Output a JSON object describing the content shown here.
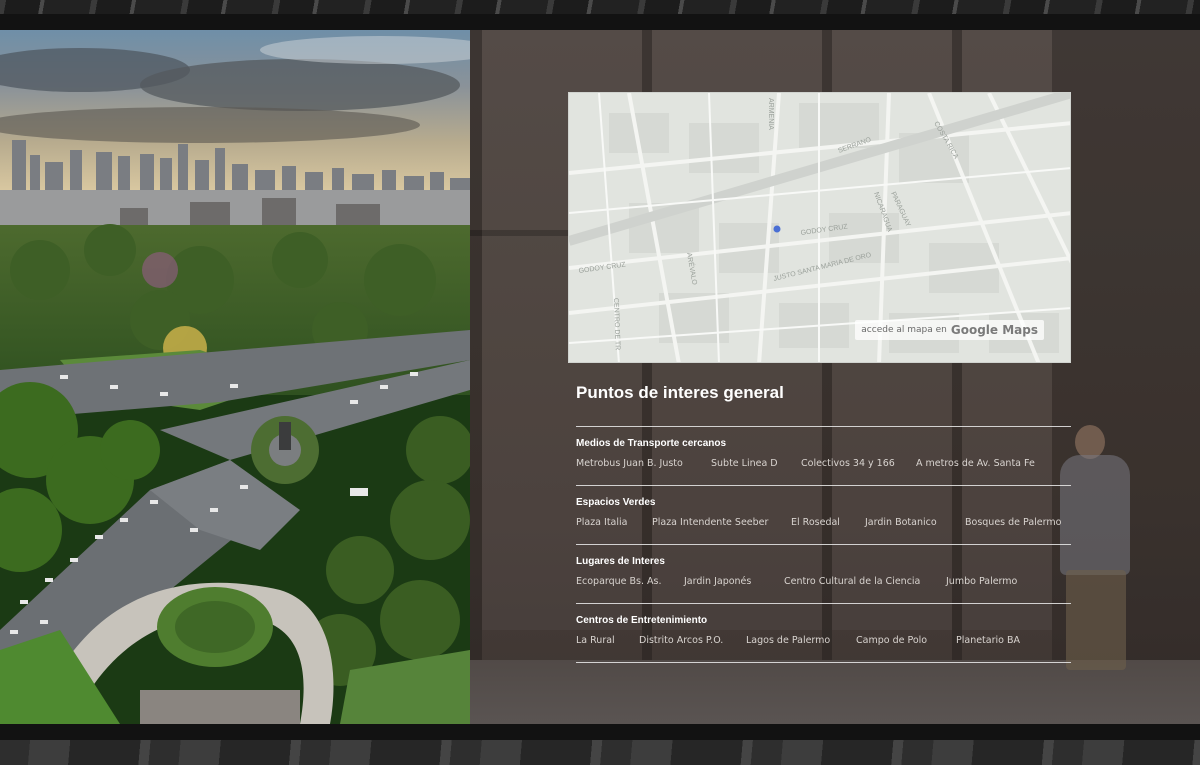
{
  "map": {
    "streets": [
      "GODOY CRUZ",
      "GODOY CRUZ",
      "JUSTO SANTA MARIA DE ORO",
      "CENTRO DE TR",
      "ARMENIA",
      "NICARAGUA",
      "PARAGUAY",
      "COSTA RICA",
      "SERRANO",
      "ARÉVALO"
    ],
    "link_prefix": "accede al mapa en",
    "link_brand": "Google Maps"
  },
  "info": {
    "title": "Puntos de interes general",
    "categories": [
      {
        "name": "Medios de Transporte cercanos",
        "items": [
          "Metrobus Juan B. Justo",
          "Subte Linea D",
          "Colectivos 34 y 166",
          "A metros de Av. Santa Fe"
        ]
      },
      {
        "name": "Espacios Verdes",
        "items": [
          "Plaza Italia",
          "Plaza Intendente Seeber",
          "El Rosedal",
          "Jardin Botanico",
          "Bosques de Palermo"
        ]
      },
      {
        "name": "Lugares de Interes",
        "items": [
          "Ecoparque Bs. As.",
          "Jardin Japonés",
          "Centro Cultural de la Ciencia",
          "Jumbo Palermo"
        ]
      },
      {
        "name": "Centros de Entretenimiento",
        "items": [
          "La Rural",
          "Distrito Arcos P.O.",
          "Lagos de Palermo",
          "Campo de Polo",
          "Planetario BA"
        ]
      }
    ]
  }
}
